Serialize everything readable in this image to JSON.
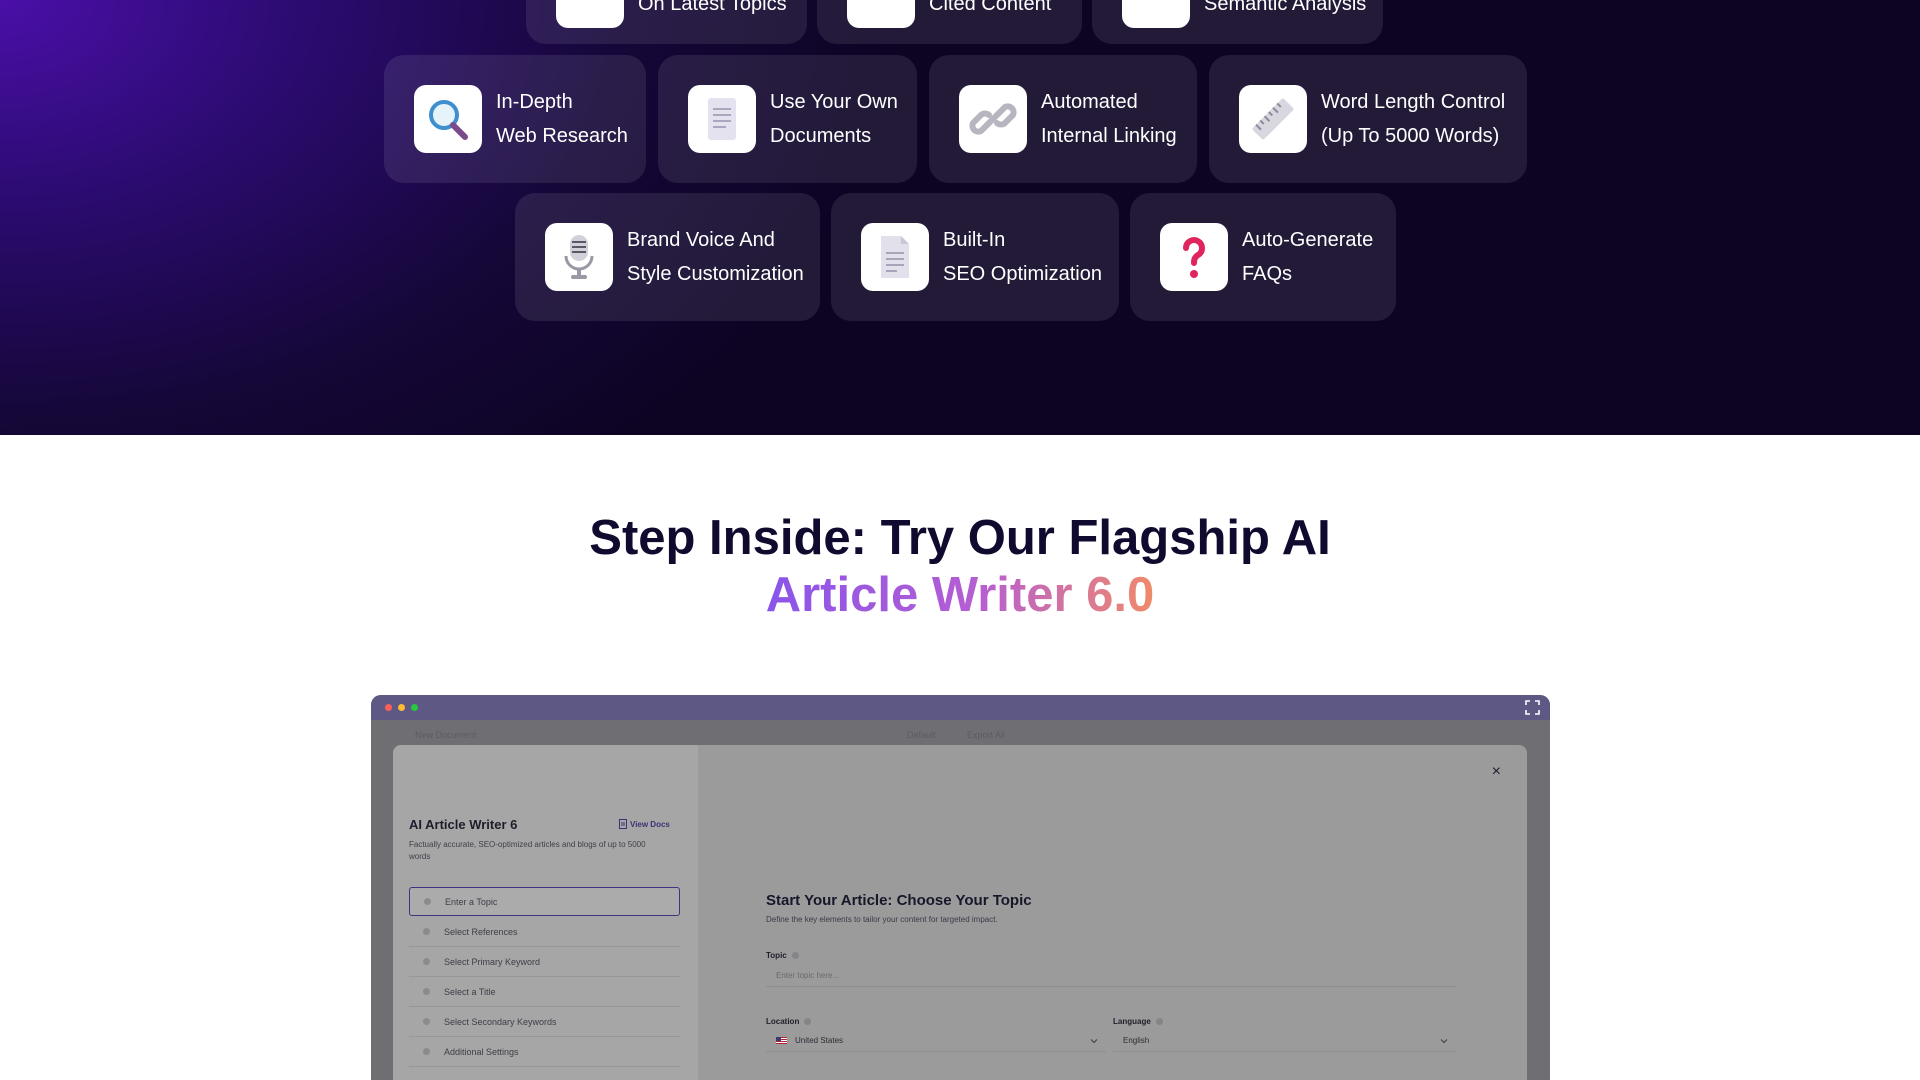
{
  "features": {
    "row0": [
      {
        "icon": "trending-icon",
        "text": "On Latest Topics"
      },
      {
        "icon": "citation-icon",
        "text": "Cited Content"
      },
      {
        "icon": "analysis-icon",
        "text": "Semantic Analysis"
      }
    ],
    "row1": [
      {
        "icon": "magnifier-icon",
        "line1": "In-Depth",
        "line2": "Web Research"
      },
      {
        "icon": "document-icon",
        "line1": "Use Your Own",
        "line2": "Documents"
      },
      {
        "icon": "link-icon",
        "line1": "Automated",
        "line2": "Internal Linking"
      },
      {
        "icon": "ruler-icon",
        "line1": "Word Length Control",
        "line2": "(Up To 5000 Words)"
      }
    ],
    "row2": [
      {
        "icon": "microphone-icon",
        "line1": "Brand Voice And",
        "line2": "Style Customization"
      },
      {
        "icon": "page-icon",
        "line1": "Built-In",
        "line2": "SEO Optimization"
      },
      {
        "icon": "question-mark-icon",
        "line1": "Auto-Generate",
        "line2": "FAQs"
      }
    ]
  },
  "headline": {
    "line1": "Step Inside: Try Our Flagship AI",
    "line2_part1": "Article Writer ",
    "line2_part2": "6.0"
  },
  "mock": {
    "under_doc_title": "New Document",
    "under_tab1": "Default",
    "under_tab2": "Export All",
    "writer_title": "AI Article Writer 6",
    "view_docs": "View Docs",
    "writer_desc": "Factually accurate, SEO-optimized articles and blogs of up to 5000 words",
    "steps": [
      "Enter a Topic",
      "Select References",
      "Select Primary Keyword",
      "Select a Title",
      "Select Secondary Keywords",
      "Additional Settings"
    ],
    "close": "×",
    "main_title": "Start Your Article: Choose Your Topic",
    "main_sub": "Define the key elements to tailor your content for targeted impact.",
    "topic_label": "Topic",
    "topic_placeholder": "Enter topic here...",
    "location_label": "Location",
    "location_value": "United States",
    "language_label": "Language",
    "language_value": "English"
  },
  "colors": {
    "hero_dark": "#150737",
    "hero_purple": "#4a0fa8",
    "headline_dark": "#0f0a2e",
    "gradient_start": "#8a55ea",
    "gradient_end": "#f08a6a"
  }
}
